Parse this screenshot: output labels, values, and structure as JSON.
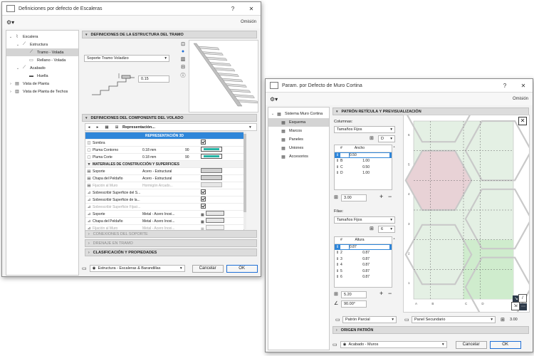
{
  "left": {
    "title": "Definiciones por defecto de Escaleras",
    "help": "?",
    "close": "✕",
    "omit": "Omisión",
    "tree": [
      {
        "label": "Escalera",
        "icon": "stair-icon",
        "arrow": "⌄",
        "indent": 0,
        "sel": false
      },
      {
        "label": "Estructura",
        "icon": "structure-icon",
        "arrow": "⌄",
        "indent": 1,
        "sel": false
      },
      {
        "label": "Tramo - Volada",
        "icon": "flight-icon",
        "arrow": "",
        "indent": 2,
        "sel": true
      },
      {
        "label": "Rellano - Volada",
        "icon": "landing-icon",
        "arrow": "",
        "indent": 2,
        "sel": false
      },
      {
        "label": "Acabado",
        "icon": "finish-icon",
        "arrow": "⌄",
        "indent": 1,
        "sel": false
      },
      {
        "label": "Huella",
        "icon": "tread-icon",
        "arrow": "",
        "indent": 2,
        "sel": false
      },
      {
        "label": "Vista de Planta",
        "icon": "plan-view-icon",
        "arrow": "›",
        "indent": 0,
        "sel": false
      },
      {
        "label": "Vista de Planta de Techos",
        "icon": "ceiling-plan-icon",
        "arrow": "›",
        "indent": 0,
        "sel": false
      }
    ],
    "sec_structure": "DEFINICIONES DE LA ESTRUCTURA DEL TRAMO",
    "support_type": "Soporte Tramo Voladizo",
    "dim_value": "0.15",
    "sec_component": "DEFINICIONES DEL COMPONENTE DEL VOLADO",
    "representation": "Representación...",
    "rows": [
      {
        "kind": "band",
        "name": "REPRESENTACIÓN 3D"
      },
      {
        "kind": "row",
        "icon": "◫",
        "name": "Sombra",
        "value": "",
        "num": "",
        "ctrl": "check-on",
        "dim": false
      },
      {
        "kind": "row",
        "icon": "▢",
        "name": "Pluma Contorno",
        "value": "0.18 mm",
        "num": "90",
        "ctrl": "pen",
        "dim": false
      },
      {
        "kind": "row",
        "icon": "▢",
        "name": "Pluma Corte",
        "value": "0.18 mm",
        "num": "90",
        "ctrl": "pen",
        "dim": false
      },
      {
        "kind": "sub",
        "name": "MATERIALES DE CONSTRUCCIÓN Y SUPERFICIES"
      },
      {
        "kind": "row",
        "icon": "▤",
        "name": "Soporte",
        "value": "Acero - Estructural",
        "num": "",
        "ctrl": "swatch",
        "dim": false
      },
      {
        "kind": "row",
        "icon": "▤",
        "name": "Chapa del Peldaño",
        "value": "Acero - Estructural",
        "num": "",
        "ctrl": "swatch",
        "dim": false
      },
      {
        "kind": "row",
        "icon": "▤",
        "name": "Fijación al Muro",
        "value": "Hormigón Arcado...",
        "num": "",
        "ctrl": "swatch",
        "dim": true
      },
      {
        "kind": "row",
        "icon": "⊿",
        "name": "Sobrescribir Superficie del S...",
        "value": "",
        "num": "",
        "ctrl": "check-on",
        "dim": false
      },
      {
        "kind": "row",
        "icon": "⊿",
        "name": "Sobrescribir Superficie de la...",
        "value": "",
        "num": "",
        "ctrl": "check-on",
        "dim": false
      },
      {
        "kind": "row",
        "icon": "⊿",
        "name": "Sobrescribir Superficie Fijaci...",
        "value": "",
        "num": "",
        "ctrl": "check-on",
        "dim": true
      },
      {
        "kind": "row",
        "icon": "⊿",
        "name": "Soporte",
        "value": "Metal - Acero Inoxi...",
        "num": "",
        "ctrl": "swatch2",
        "dim": false
      },
      {
        "kind": "row",
        "icon": "⊿",
        "name": "Chapa del Peldaño",
        "value": "Metal - Acero Inoxi...",
        "num": "",
        "ctrl": "swatch2",
        "dim": false
      },
      {
        "kind": "row",
        "icon": "⊿",
        "name": "Fijación al Muro",
        "value": "Metal - Acero Inoxi...",
        "num": "",
        "ctrl": "swatch2",
        "dim": true
      }
    ],
    "sec_support_conn": "CONEXIONES DEL SOPORTE",
    "sec_drain": "DRENAJE EN TRAMO",
    "sec_class": "CLASIFICACIÓN Y PROPIEDADES",
    "layer": "Estructura - Escaleras & Barandillas",
    "cancel": "Cancelar",
    "ok": "OK"
  },
  "right": {
    "title": "Param. por Defecto de Muro Cortina",
    "help": "?",
    "close": "✕",
    "omit": "Omisión",
    "tree": [
      {
        "label": "Sistema Muro Cortina",
        "arrow": "⌄",
        "indent": 0,
        "sel": false
      },
      {
        "label": "Esquema",
        "arrow": "",
        "indent": 1,
        "sel": true
      },
      {
        "label": "Marcos",
        "arrow": "",
        "indent": 1,
        "sel": false
      },
      {
        "label": "Paneles",
        "arrow": "",
        "indent": 1,
        "sel": false
      },
      {
        "label": "Uniones",
        "arrow": "",
        "indent": 1,
        "sel": false
      },
      {
        "label": "Accesorios",
        "arrow": "",
        "indent": 1,
        "sel": false
      }
    ],
    "sec_pattern": "PATRÓN RETÍCULA Y PREVISUALIZACIÓN",
    "columns_label": "Columnas:",
    "columns_mode": "Tamaños Fijos",
    "columns_count": "D",
    "col_head_num": "#",
    "col_head_val": "Ancho",
    "columns": [
      {
        "id": "A",
        "val": "0.50",
        "sel": true
      },
      {
        "id": "B",
        "val": "1.00",
        "sel": false
      },
      {
        "id": "C",
        "val": "0.50",
        "sel": false
      },
      {
        "id": "D",
        "val": "1.00",
        "sel": false
      }
    ],
    "columns_total": "3.00",
    "rows_label": "Filas:",
    "rows_mode": "Tamaños Fijos",
    "rows_count": "6",
    "row_head_val": "Altura",
    "rows": [
      {
        "id": "1",
        "val": "0.87",
        "sel": true
      },
      {
        "id": "2",
        "val": "0.87",
        "sel": false
      },
      {
        "id": "3",
        "val": "0.87",
        "sel": false
      },
      {
        "id": "4",
        "val": "0.87",
        "sel": false
      },
      {
        "id": "5",
        "val": "0.87",
        "sel": false
      },
      {
        "id": "6",
        "val": "0.87",
        "sel": false
      }
    ],
    "rows_total": "5.20",
    "angle": "90.00°",
    "grid_cols": [
      "A",
      "B",
      "C",
      "D"
    ],
    "grid_rows": [
      "6",
      "5",
      "4",
      "3",
      "2",
      "1"
    ],
    "pattern_mode": "Patrón Parcial",
    "panel_mode": "Panel Secundario",
    "panel_value": "3.00",
    "sec_origin": "ORIGEN PATRÓN",
    "layer": "Acabado - Muros",
    "cancel": "Cancelar",
    "ok": "OK",
    "colors": {
      "pink": "#e8d2d6",
      "green": "#cfeccd",
      "grid": "#e4f0e4",
      "frame": "#c9c9c9"
    }
  }
}
